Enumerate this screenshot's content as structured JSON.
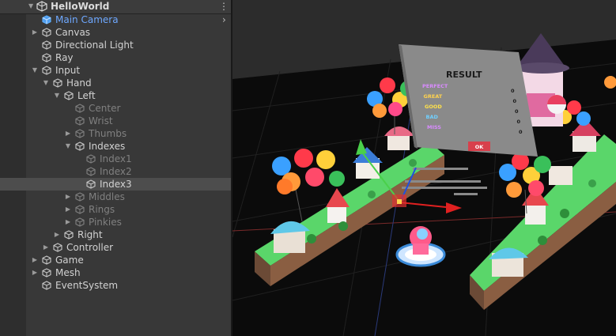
{
  "hierarchy": {
    "scene_name": "HelloWorld",
    "rows": [
      {
        "label": "Main Camera",
        "depth": 1,
        "expand": "none",
        "state": "camera"
      },
      {
        "label": "Canvas",
        "depth": 1,
        "expand": "collapsed",
        "state": "normal"
      },
      {
        "label": "Directional Light",
        "depth": 1,
        "expand": "none",
        "state": "normal"
      },
      {
        "label": "Ray",
        "depth": 1,
        "expand": "none",
        "state": "normal"
      },
      {
        "label": "Input",
        "depth": 1,
        "expand": "expanded",
        "state": "normal"
      },
      {
        "label": "Hand",
        "depth": 2,
        "expand": "expanded",
        "state": "normal"
      },
      {
        "label": "Left",
        "depth": 3,
        "expand": "expanded",
        "state": "normal"
      },
      {
        "label": "Center",
        "depth": 4,
        "expand": "none",
        "state": "disabled"
      },
      {
        "label": "Wrist",
        "depth": 4,
        "expand": "none",
        "state": "disabled"
      },
      {
        "label": "Thumbs",
        "depth": 4,
        "expand": "collapsed",
        "state": "disabled"
      },
      {
        "label": "Indexes",
        "depth": 4,
        "expand": "expanded",
        "state": "normal"
      },
      {
        "label": "Index1",
        "depth": 5,
        "expand": "none",
        "state": "disabled"
      },
      {
        "label": "Index2",
        "depth": 5,
        "expand": "none",
        "state": "disabled"
      },
      {
        "label": "Index3",
        "depth": 5,
        "expand": "none",
        "state": "selected"
      },
      {
        "label": "Middles",
        "depth": 4,
        "expand": "collapsed",
        "state": "disabled"
      },
      {
        "label": "Rings",
        "depth": 4,
        "expand": "collapsed",
        "state": "disabled"
      },
      {
        "label": "Pinkies",
        "depth": 4,
        "expand": "collapsed",
        "state": "disabled"
      },
      {
        "label": "Right",
        "depth": 3,
        "expand": "collapsed",
        "state": "normal"
      },
      {
        "label": "Controller",
        "depth": 2,
        "expand": "collapsed",
        "state": "normal"
      },
      {
        "label": "Game",
        "depth": 1,
        "expand": "collapsed",
        "state": "normal"
      },
      {
        "label": "Mesh",
        "depth": 1,
        "expand": "collapsed",
        "state": "normal"
      },
      {
        "label": "EventSystem",
        "depth": 1,
        "expand": "none",
        "state": "normal"
      }
    ]
  },
  "scene": {
    "result_panel": {
      "title": "RESULT",
      "rows": [
        {
          "label": "PERFECT",
          "value": "0",
          "color": "#d98bff"
        },
        {
          "label": "GREAT",
          "value": "0",
          "color": "#ffd24d"
        },
        {
          "label": "GOOD",
          "value": "0",
          "color": "#ffe14a"
        },
        {
          "label": "BAD",
          "value": "0",
          "color": "#6fd0ff"
        },
        {
          "label": "MISS",
          "value": "0",
          "color": "#d98bff"
        }
      ],
      "ok_label": "OK"
    }
  }
}
